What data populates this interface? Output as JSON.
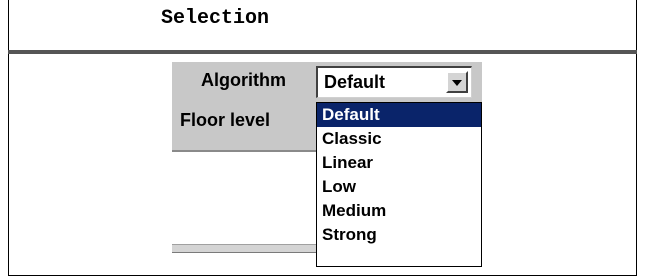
{
  "header": {
    "title": "Selection"
  },
  "form": {
    "algorithm_label": "Algorithm",
    "floor_level_label": "Floor level",
    "algorithm_value": "Default"
  },
  "dropdown": {
    "selected_index": 0,
    "options": [
      "Default",
      "Classic",
      "Linear",
      "Low",
      "Medium",
      "Strong"
    ]
  },
  "colors": {
    "selection_bg": "#0a246a",
    "panel_bg": "#c8c8c8"
  },
  "icons": {
    "dropdown_arrow": "chevron-down-icon"
  }
}
